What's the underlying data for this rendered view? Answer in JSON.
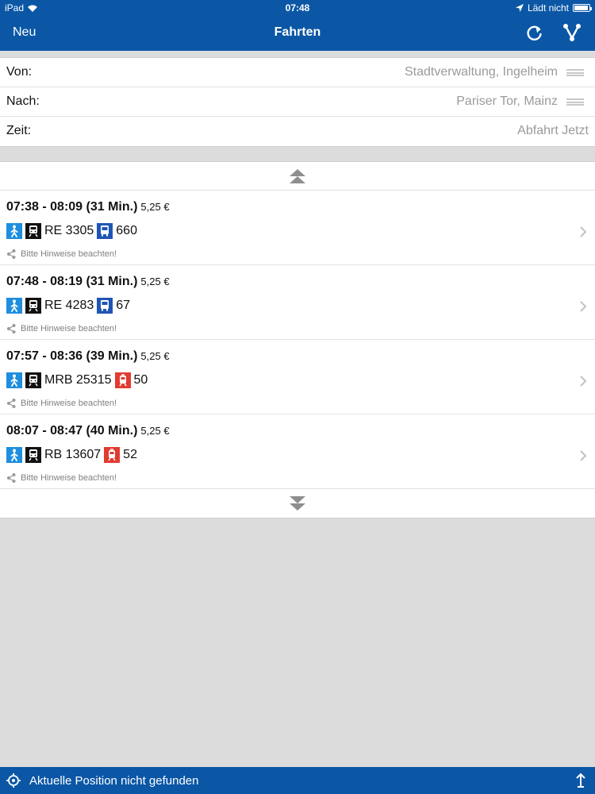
{
  "status_bar": {
    "device": "iPad",
    "time": "07:48",
    "charging": "Lädt nicht"
  },
  "nav": {
    "left_button": "Neu",
    "title": "Fahrten",
    "icons": [
      "refresh-icon",
      "fork-icon"
    ]
  },
  "form": {
    "from_label": "Von:",
    "from_value": "Stadtverwaltung, Ingelheim",
    "to_label": "Nach:",
    "to_value": "Pariser Tor, Mainz",
    "time_label": "Zeit:",
    "time_value": "Abfahrt Jetzt"
  },
  "trips": [
    {
      "times": "07:38 - 08:09 (31 Min.)",
      "price": "5,25 €",
      "train_line": "RE 3305",
      "second_mode": "bus",
      "second_line": "660",
      "note": "Bitte Hinweise beachten!"
    },
    {
      "times": "07:48 - 08:19 (31 Min.)",
      "price": "5,25 €",
      "train_line": "RE 4283",
      "second_mode": "bus",
      "second_line": "67",
      "note": "Bitte Hinweise beachten!"
    },
    {
      "times": "07:57 - 08:36 (39 Min.)",
      "price": "5,25 €",
      "train_line": "MRB 25315",
      "second_mode": "tram",
      "second_line": "50",
      "note": "Bitte Hinweise beachten!"
    },
    {
      "times": "08:07 - 08:47 (40 Min.)",
      "price": "5,25 €",
      "train_line": "RB 13607",
      "second_mode": "tram",
      "second_line": "52",
      "note": "Bitte Hinweise beachten!"
    }
  ],
  "bottom_bar": {
    "text": "Aktuelle Position nicht gefunden"
  },
  "colors": {
    "brand_blue": "#0b57a6",
    "walk_badge": "#1e8ede",
    "bus_badge": "#1f56b4",
    "tram_badge": "#e23b30",
    "train_badge": "#111111"
  }
}
